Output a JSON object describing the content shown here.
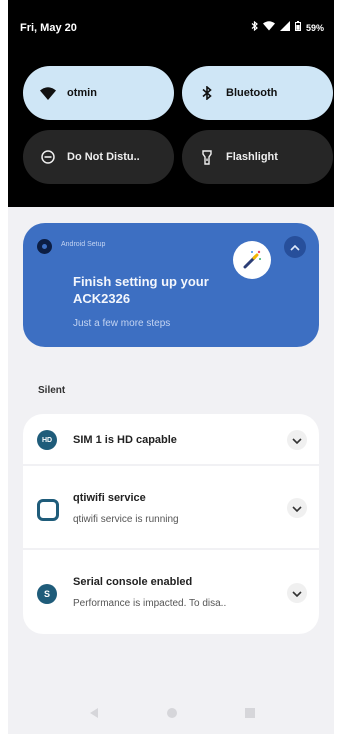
{
  "status_bar": {
    "time": "Fri, May 20",
    "battery": "59%",
    "icons": [
      "bluetooth-icon",
      "wifi-icon",
      "signal-icon",
      "battery-icon"
    ]
  },
  "quick_settings": [
    {
      "label": "otmin",
      "icon": "wifi-icon",
      "state": "on"
    },
    {
      "label": "Bluetooth",
      "icon": "bluetooth-icon",
      "state": "on"
    },
    {
      "label": "Do Not Distu..",
      "icon": "do-not-disturb-icon",
      "state": "off"
    },
    {
      "label": "Flashlight",
      "icon": "flashlight-icon",
      "state": "off"
    }
  ],
  "setup_card": {
    "app_name": "Android Setup",
    "title": "Finish setting up your ACK2326",
    "subtitle": "Just a few more steps",
    "accent": "#3d6fc2"
  },
  "section_label": "Silent",
  "notifications": [
    {
      "title": "SIM 1 is HD capable",
      "text": "",
      "icon": "hd-icon"
    },
    {
      "title": "qtiwifi service",
      "text": "qtiwifi service is running",
      "icon": "square-icon"
    },
    {
      "title": "Serial console enabled",
      "text": "Performance is impacted. To disa..",
      "icon": "serial-icon"
    }
  ],
  "navigation": [
    "back-icon",
    "home-icon",
    "recents-icon"
  ]
}
